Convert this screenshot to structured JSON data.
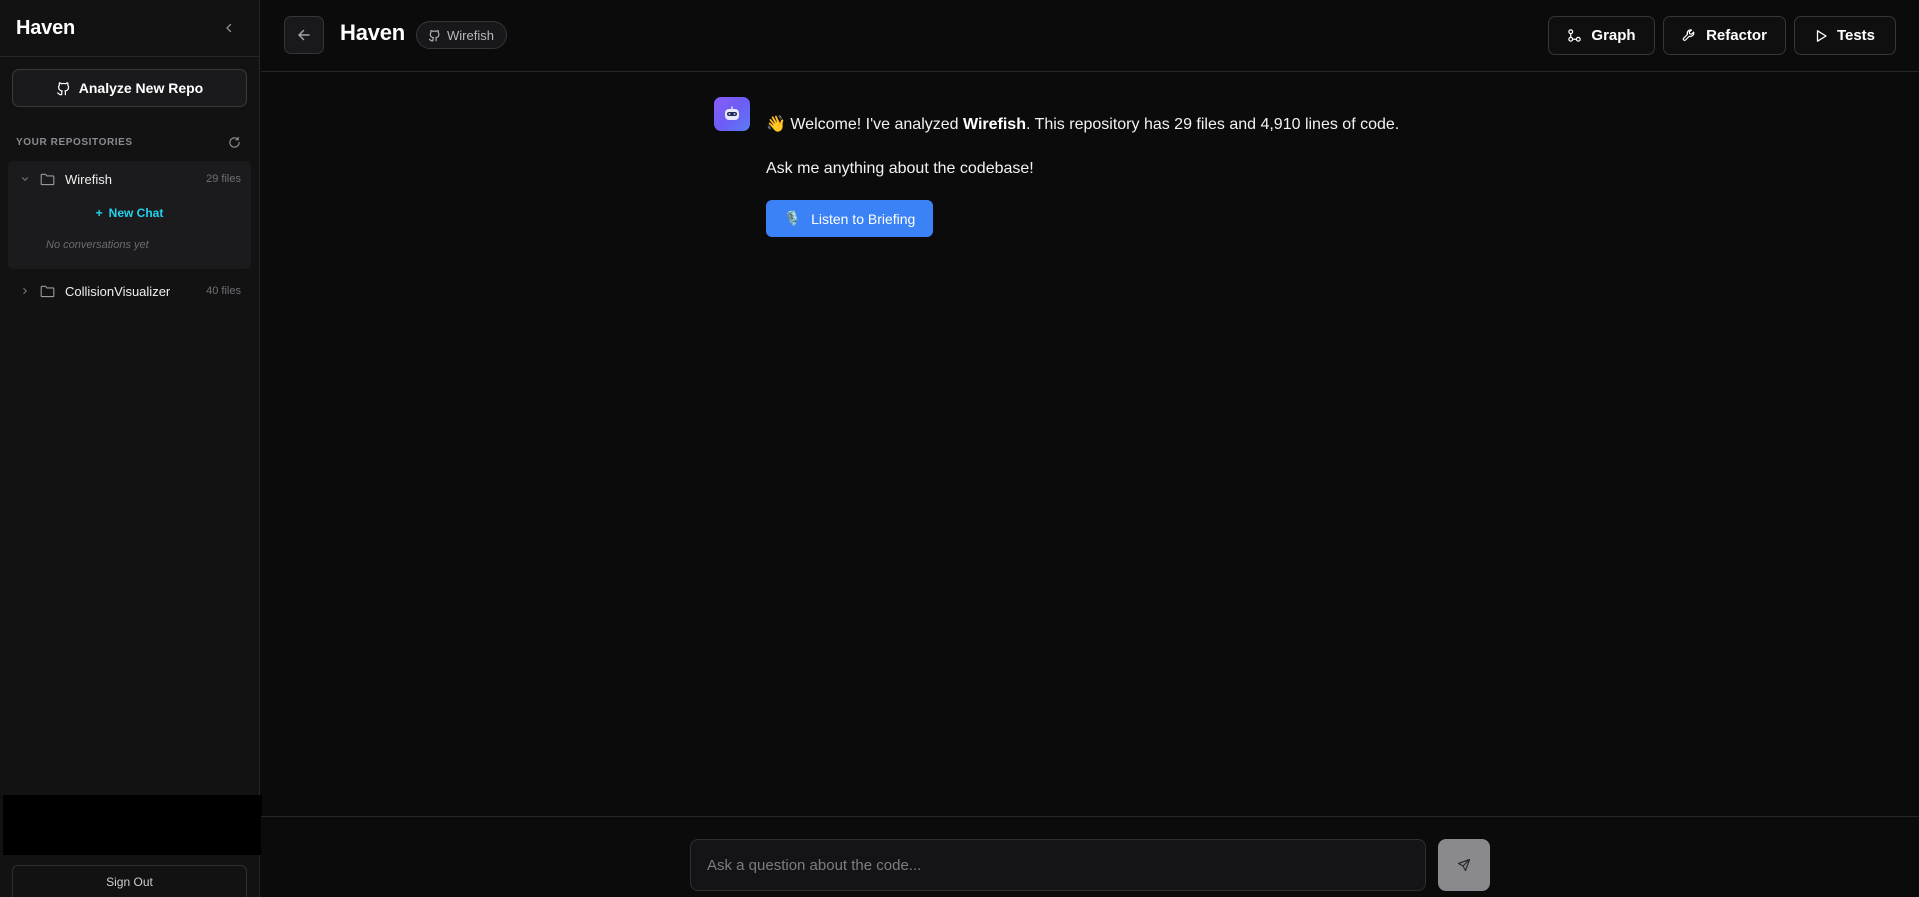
{
  "sidebar": {
    "title": "Haven",
    "analyze_label": "Analyze New Repo",
    "repos_label": "YOUR REPOSITORIES",
    "repos": [
      {
        "name": "Wirefish",
        "count": "29 files",
        "new_chat": "New Chat",
        "empty": "No conversations yet"
      },
      {
        "name": "CollisionVisualizer",
        "count": "40 files"
      }
    ],
    "signout_label": "Sign Out"
  },
  "header": {
    "title": "Haven",
    "repo_chip": "Wirefish",
    "buttons": {
      "graph": "Graph",
      "refactor": "Refactor",
      "tests": "Tests"
    }
  },
  "message": {
    "wave": "👋",
    "prefix": " Welcome! I've analyzed ",
    "repo": "Wirefish",
    "suffix": ". This repository has 29 files and 4,910 lines of code.",
    "line2": "Ask me anything about the codebase!",
    "listen_icon": "🎙️",
    "listen_label": "Listen to Briefing"
  },
  "composer": {
    "placeholder": "Ask a question about the code..."
  },
  "colors": {
    "accent_blue": "#3b82f6",
    "accent_cyan": "#22d3ee",
    "avatar_purple": "#8b5cf6"
  },
  "icons": {
    "collapse": "chevron-left-icon",
    "github": "github-icon",
    "refresh": "refresh-icon",
    "folder": "folder-icon",
    "back": "arrow-left-icon",
    "graph": "graph-icon",
    "refactor": "wrench-icon",
    "tests": "play-icon",
    "bot": "robot-icon",
    "send": "send-icon"
  }
}
